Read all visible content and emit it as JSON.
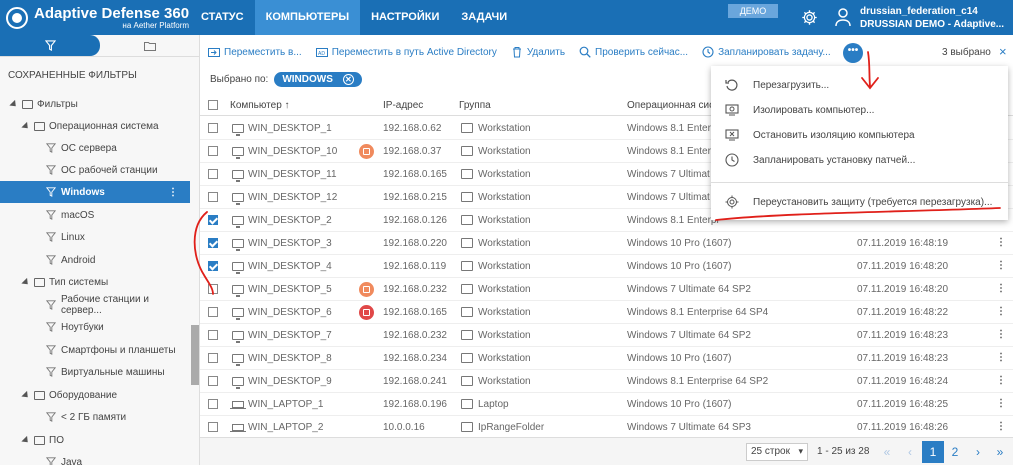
{
  "app": {
    "title": "Adaptive Defense 360",
    "subtitle": "на Aether Platform"
  },
  "nav": [
    {
      "label": "СТАТУС"
    },
    {
      "label": "КОМПЬЮТЕРЫ"
    },
    {
      "label": "НАСТРОЙКИ"
    },
    {
      "label": "ЗАДАЧИ"
    }
  ],
  "header": {
    "demo_badge": "ДЕМО",
    "user_name": "drussian_federation_c14",
    "user_account": "DRUSSIAN DEMO - Adaptive..."
  },
  "sidebar": {
    "heading": "СОХРАНЕННЫЕ ФИЛЬТРЫ",
    "items": [
      {
        "label": "Фильтры"
      },
      {
        "label": "Операционная система"
      },
      {
        "label": "ОС сервера"
      },
      {
        "label": "ОС рабочей станции"
      },
      {
        "label": "Windows"
      },
      {
        "label": "macOS"
      },
      {
        "label": "Linux"
      },
      {
        "label": "Android"
      },
      {
        "label": "Тип системы"
      },
      {
        "label": "Рабочие станции и сервер..."
      },
      {
        "label": "Ноутбуки"
      },
      {
        "label": "Смартфоны и планшеты"
      },
      {
        "label": "Виртуальные машины"
      },
      {
        "label": "Оборудование"
      },
      {
        "label": "< 2 ГБ памяти"
      },
      {
        "label": "ПО"
      },
      {
        "label": "Java"
      }
    ]
  },
  "toolbar": {
    "move": "Переместить в...",
    "move_ad": "Переместить в путь Active Directory",
    "delete": "Удалить",
    "check": "Проверить сейчас...",
    "schedule": "Запланировать задачу...",
    "more": "•••",
    "selected": "3 выбрано",
    "close": "×"
  },
  "filter_bar": {
    "label": "Выбрано по:",
    "chip": "WINDOWS"
  },
  "table": {
    "headers": {
      "computer": "Компьютер ↑",
      "ip": "IP-адрес",
      "group": "Группа",
      "os": "Операционная сис"
    },
    "rows": [
      {
        "name": "WIN_DESKTOP_1",
        "ip": "192.168.0.62",
        "group": "Workstation",
        "os": "Windows 8.1 Enterpr",
        "time": "",
        "checked": false,
        "status": "",
        "type": "pc"
      },
      {
        "name": "WIN_DESKTOP_10",
        "ip": "192.168.0.37",
        "group": "Workstation",
        "os": "Windows 8.1 Enterpr",
        "time": "",
        "checked": false,
        "status": "orange",
        "type": "pc"
      },
      {
        "name": "WIN_DESKTOP_11",
        "ip": "192.168.0.165",
        "group": "Workstation",
        "os": "Windows 7 Ultimat",
        "time": "",
        "checked": false,
        "status": "",
        "type": "pc"
      },
      {
        "name": "WIN_DESKTOP_12",
        "ip": "192.168.0.215",
        "group": "Workstation",
        "os": "Windows 7 Ultimat",
        "time": "",
        "checked": false,
        "status": "",
        "type": "pc"
      },
      {
        "name": "WIN_DESKTOP_2",
        "ip": "192.168.0.126",
        "group": "Workstation",
        "os": "Windows 8.1 Enterpr",
        "time": "",
        "checked": true,
        "status": "",
        "type": "pc"
      },
      {
        "name": "WIN_DESKTOP_3",
        "ip": "192.168.0.220",
        "group": "Workstation",
        "os": "Windows 10 Pro (1607)",
        "time": "07.11.2019 16:48:19",
        "checked": true,
        "status": "",
        "type": "pc"
      },
      {
        "name": "WIN_DESKTOP_4",
        "ip": "192.168.0.119",
        "group": "Workstation",
        "os": "Windows 10 Pro (1607)",
        "time": "07.11.2019 16:48:20",
        "checked": true,
        "status": "",
        "type": "pc"
      },
      {
        "name": "WIN_DESKTOP_5",
        "ip": "192.168.0.232",
        "group": "Workstation",
        "os": "Windows 7 Ultimate 64 SP2",
        "time": "07.11.2019 16:48:20",
        "checked": false,
        "status": "orange",
        "type": "pc"
      },
      {
        "name": "WIN_DESKTOP_6",
        "ip": "192.168.0.165",
        "group": "Workstation",
        "os": "Windows 8.1 Enterprise 64 SP4",
        "time": "07.11.2019 16:48:22",
        "checked": false,
        "status": "red",
        "type": "pc"
      },
      {
        "name": "WIN_DESKTOP_7",
        "ip": "192.168.0.232",
        "group": "Workstation",
        "os": "Windows 7 Ultimate 64 SP2",
        "time": "07.11.2019 16:48:23",
        "checked": false,
        "status": "",
        "type": "pc"
      },
      {
        "name": "WIN_DESKTOP_8",
        "ip": "192.168.0.234",
        "group": "Workstation",
        "os": "Windows 10 Pro (1607)",
        "time": "07.11.2019 16:48:23",
        "checked": false,
        "status": "",
        "type": "pc"
      },
      {
        "name": "WIN_DESKTOP_9",
        "ip": "192.168.0.241",
        "group": "Workstation",
        "os": "Windows 8.1 Enterprise 64 SP2",
        "time": "07.11.2019 16:48:24",
        "checked": false,
        "status": "",
        "type": "pc"
      },
      {
        "name": "WIN_LAPTOP_1",
        "ip": "192.168.0.196",
        "group": "Laptop",
        "os": "Windows 10 Pro (1607)",
        "time": "07.11.2019 16:48:25",
        "checked": false,
        "status": "",
        "type": "laptop"
      },
      {
        "name": "WIN_LAPTOP_2",
        "ip": "10.0.0.16",
        "group": "IpRangeFolder",
        "os": "Windows 7 Ultimate 64 SP3",
        "time": "07.11.2019 16:48:26",
        "checked": false,
        "status": "",
        "type": "laptop"
      }
    ]
  },
  "menu": {
    "items": [
      {
        "label": "Перезагрузить..."
      },
      {
        "label": "Изолировать компьютер..."
      },
      {
        "label": "Остановить изоляцию компьютера"
      },
      {
        "label": "Запланировать установку патчей..."
      },
      {
        "label": "Переустановить защиту (требуется перезагрузка)..."
      }
    ]
  },
  "footer": {
    "rows_per_page": "25 строк",
    "range": "1 - 25 из 28",
    "page_1": "1",
    "page_2": "2"
  },
  "colors": {
    "brand": "#1a6fb5",
    "accent": "#2a7dc4",
    "annotation": "#e0201a"
  }
}
